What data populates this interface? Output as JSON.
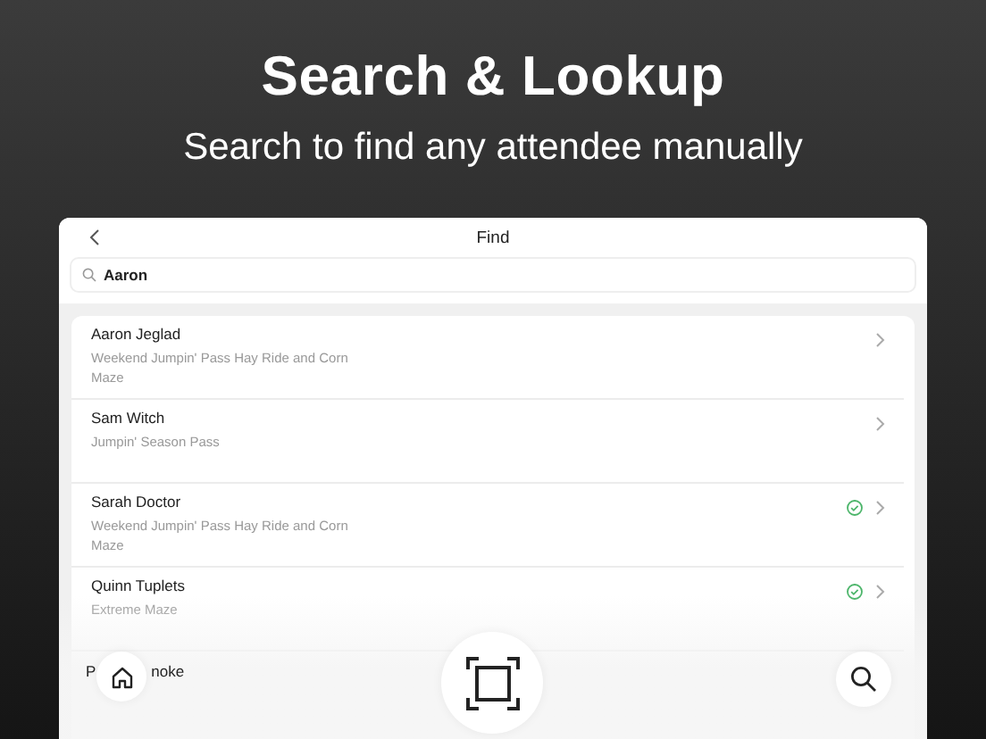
{
  "headline": "Search & Lookup",
  "subheadline": "Search to find any attendee manually",
  "screen": {
    "title": "Find",
    "search": {
      "value": "Aaron"
    },
    "rows": [
      {
        "name": "Aaron Jeglad",
        "ticket": "Weekend Jumpin' Pass Hay Ride and Corn Maze",
        "checked_in": false
      },
      {
        "name": "Sam Witch",
        "ticket": "Jumpin' Season Pass",
        "checked_in": false
      },
      {
        "name": "Sarah Doctor",
        "ticket": "Weekend Jumpin' Pass Hay Ride and Corn Maze",
        "checked_in": true
      },
      {
        "name": "Quinn Tuplets",
        "ticket": "Extreme Maze",
        "checked_in": true
      }
    ],
    "partial_row": {
      "name_parts": [
        "P",
        "noke"
      ]
    }
  }
}
